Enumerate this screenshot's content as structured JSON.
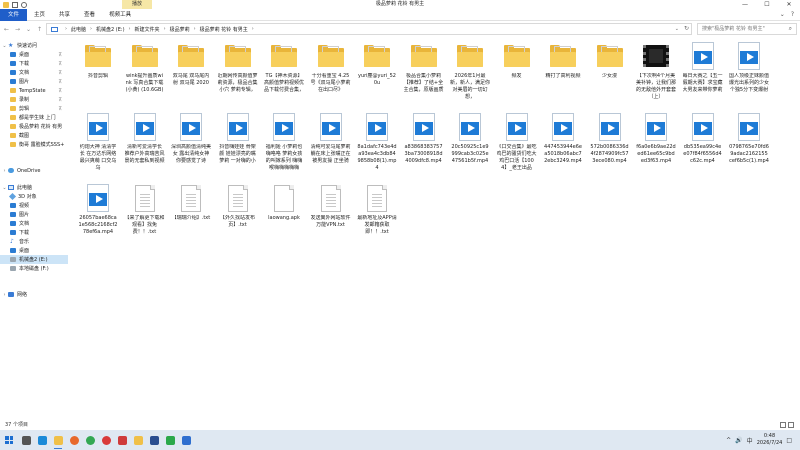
{
  "window": {
    "title": "极品萝莉 花铃 有男主",
    "tools_tab": "播放",
    "controls": [
      "—",
      "☐",
      "✕"
    ]
  },
  "ribbon": {
    "tabs": [
      "文件",
      "主页",
      "共享",
      "查看",
      "视频工具"
    ]
  },
  "address": {
    "crumbs": [
      "此电脑",
      "机械盘2 (E:)",
      "新建文件夹",
      "极品萝莉",
      "极品萝莉 花铃 有男主"
    ],
    "search_placeholder": "搜索\"极品萝莉 花铃 有男主\""
  },
  "nav": {
    "items": [
      {
        "label": "快速访问",
        "icon": "star-icon",
        "level": 0,
        "expand": "v"
      },
      {
        "label": "桌面",
        "icon": "desktop-folder-icon",
        "level": 1,
        "pin": true
      },
      {
        "label": "下载",
        "icon": "download-folder-icon",
        "level": 1,
        "pin": true
      },
      {
        "label": "文档",
        "icon": "documents-folder-icon",
        "level": 1,
        "pin": true
      },
      {
        "label": "图片",
        "icon": "pictures-folder-icon",
        "level": 1,
        "pin": true
      },
      {
        "label": "TempState",
        "icon": "folder-icon",
        "level": 1,
        "pin": true
      },
      {
        "label": "录制",
        "icon": "folder-icon",
        "level": 1,
        "pin": true
      },
      {
        "label": "剪辑",
        "icon": "folder-icon",
        "level": 1,
        "pin": true
      },
      {
        "label": "都是学生妹 上门",
        "icon": "folder-icon",
        "level": 1
      },
      {
        "label": "极品萝莉 花铃 有男",
        "icon": "folder-icon",
        "level": 1
      },
      {
        "label": "截图",
        "icon": "folder-icon",
        "level": 1
      },
      {
        "label": "衡哥 露脸模式SSS+",
        "icon": "folder-icon",
        "level": 1
      },
      {
        "label": "OneDrive",
        "icon": "cloud-icon",
        "level": 0,
        "expand": ">"
      },
      {
        "label": "此电脑",
        "icon": "computer-icon",
        "level": 0,
        "expand": "v"
      },
      {
        "label": "3D 对象",
        "icon": "3d-objects-icon",
        "level": 1
      },
      {
        "label": "视频",
        "icon": "videos-folder-icon",
        "level": 1
      },
      {
        "label": "图片",
        "icon": "pictures-folder-icon",
        "level": 1
      },
      {
        "label": "文档",
        "icon": "documents-folder-icon",
        "level": 1
      },
      {
        "label": "下载",
        "icon": "download-folder-icon",
        "level": 1
      },
      {
        "label": "音乐",
        "icon": "music-icon",
        "level": 1
      },
      {
        "label": "桌面",
        "icon": "desktop-folder-icon",
        "level": 1
      },
      {
        "label": "机械盘2 (E:)",
        "icon": "drive-icon",
        "level": 1,
        "selected": true
      },
      {
        "label": "本地磁盘 (F:)",
        "icon": "drive-icon",
        "level": 1
      },
      {
        "label": "网络",
        "icon": "network-icon",
        "level": 0,
        "expand": ">"
      }
    ]
  },
  "files": [
    {
      "name": "抖音剪辑",
      "type": "folder"
    },
    {
      "name": "wink提升画质wink 写真合集下载(小黄) (10.6GB)",
      "type": "folder"
    },
    {
      "name": "双马尾 双马尾内射 双马尾 2020",
      "type": "folder"
    },
    {
      "name": "近期网传高颜值萝莉资源，极品合集小穴 萝莉专辑，",
      "type": "folder"
    },
    {
      "name": "TG【神木资源】高颜值萝莉视频优品下载付费合集，",
      "type": "folder"
    },
    {
      "name": "十分看重宝 4.25号《双马尾小萝莉在出口尽》",
      "type": "folder"
    },
    {
      "name": "yuri塵@yuri_520u",
      "type": "folder"
    },
    {
      "name": "极品合集小萝莉【推荐】了结+全主合集，原版画质",
      "type": "folder"
    },
    {
      "name": "2026年1月最新，新人，满足你对美眉的一切幻想，",
      "type": "folder"
    },
    {
      "name": "频发",
      "type": "folder"
    },
    {
      "name": "精打了高利视频",
      "type": "folder"
    },
    {
      "name": "少女漫",
      "type": "folder"
    },
    {
      "name": "【下次啊4个月美美补钟，让我们那的无敌他外开套套（上）",
      "type": "film"
    },
    {
      "name": "每日大赛之【五一假期大赛】求宝藏大男友来带你萝莉",
      "type": "video"
    },
    {
      "name": "国人顶级正妹颜值爆光出系列的少女个独5分下变爆射",
      "type": "video"
    },
    {
      "name": "约炮大神 清清学长 在万达乐网络最兴爽萌 口交乌乌",
      "type": "video"
    },
    {
      "name": "清新可爱清学长 推荐户外高瑞苦风景的无套私到视频",
      "type": "video"
    },
    {
      "name": "深圳高颜值清纯美女 露出清纯女神 你要感觉了诗",
      "type": "video"
    },
    {
      "name": "抖音嗨娃娃 骨架颜 娃娃漂亮的嘴萝莉 一对嗨的小",
      "type": "video"
    },
    {
      "name": "福利姬 小萝莉也嗨咯咯 萝莉女孩的叫嫁系列 嗨嗨喉嗨嗨嗨嗨嗨",
      "type": "video"
    },
    {
      "name": "清纯可爱马尾萝莉躺在床上张嘴正在被男友操 正坐骑",
      "type": "video"
    },
    {
      "name": "8a1dafc743e4da93ea4c3db849858b08(1).mp4",
      "type": "video"
    },
    {
      "name": "a838683837573ba73008918d4009dfc8.mp4",
      "type": "video"
    },
    {
      "name": "20c50925c1e9999cab3c025e47561b5f.mp4",
      "type": "video"
    },
    {
      "name": "《口交合集》最吃鸡巴的骚货们吃大鸡巴口活【1004】_老王出品",
      "type": "video"
    },
    {
      "name": "447453944e6ea5018b06abc72ebc3249.mp4",
      "type": "video"
    },
    {
      "name": "572b0086336d4f2874909fc573ece080.mp4",
      "type": "video"
    },
    {
      "name": "f6a0e6b9ae22ded61ee65c9bded3f63.mp4",
      "type": "video"
    },
    {
      "name": "db535ea99c4ee07f84f6556d4c62c.mp4",
      "type": "video"
    },
    {
      "name": "0798765e70fd69adac2162155cef6b5c(1).mp4",
      "type": "video"
    },
    {
      "name": "26057bae68ca1e568c2168cf278ef6a.mp4",
      "type": "video"
    },
    {
      "name": "【来了解更下载和观看】找免费！！.txt",
      "type": "txt"
    },
    {
      "name": "【瑞瑞介绍】.txt",
      "type": "txt"
    },
    {
      "name": "【外久找站发布页】.txt",
      "type": "txt"
    },
    {
      "name": "laowang.apk",
      "type": "apk"
    },
    {
      "name": "发送翼外网站软件万能VPN.txt",
      "type": "txt"
    },
    {
      "name": "最新地址及APP请发邮箱获取即！！.txt",
      "type": "txt"
    }
  ],
  "status": {
    "count": "37 个项目"
  },
  "taskbar": {
    "apps": [
      {
        "name": "task-view-icon",
        "color": "#555555"
      },
      {
        "name": "edge-icon",
        "color": "#1b8ad8"
      },
      {
        "name": "explorer-icon",
        "color": "#f0c048"
      },
      {
        "name": "firefox-icon",
        "color": "#e8692c"
      },
      {
        "name": "chrome-icon",
        "color": "#34a853"
      },
      {
        "name": "player-icon",
        "color": "#d93a3a"
      },
      {
        "name": "media-app-icon",
        "color": "#cf3b3b"
      },
      {
        "name": "folder-app-icon",
        "color": "#f0c048"
      },
      {
        "name": "ps-icon",
        "color": "#2a4d8f"
      },
      {
        "name": "green-app-icon",
        "color": "#2ba84a"
      },
      {
        "name": "blue-app-icon",
        "color": "#2f6fcf"
      }
    ],
    "time": "0:48",
    "date": "2026/7/24",
    "lang": "中",
    "tray_up": "^",
    "speaker": "🔊",
    "notification": "□"
  }
}
